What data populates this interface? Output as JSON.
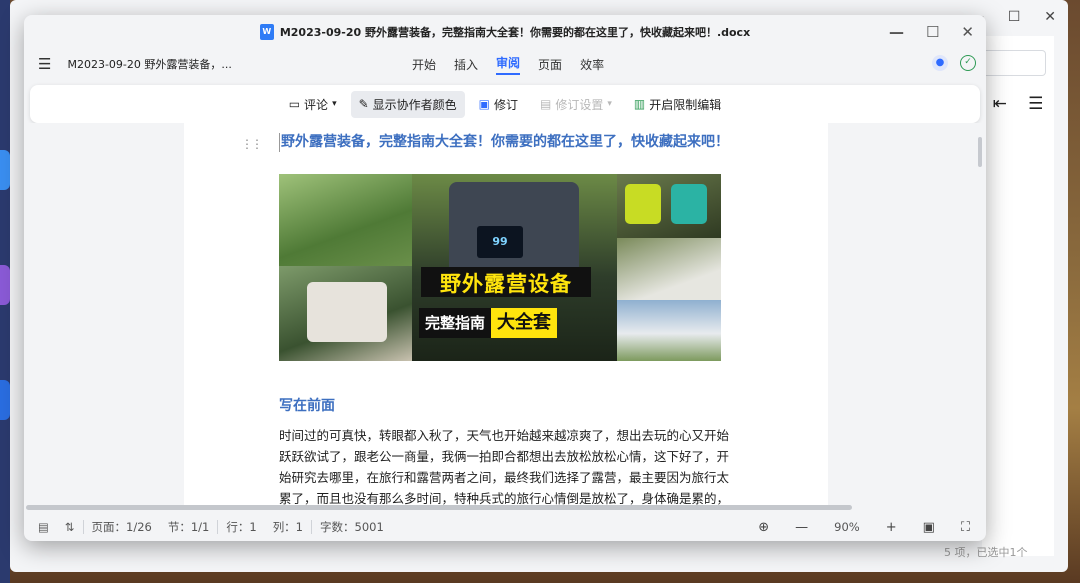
{
  "window": {
    "title": "M2023-09-20 野外露营装备，完整指南大全套！你需要的都在这里了，快收藏起来吧！.docx",
    "doc_short_title": "M2023-09-20 野外露营装备，...",
    "controls": {
      "minimize": "—",
      "maximize": "☐",
      "close": "✕"
    }
  },
  "menu": {
    "tabs": [
      "开始",
      "插入",
      "审阅",
      "页面",
      "效率"
    ],
    "active_tab": "审阅"
  },
  "toolbar": {
    "comment": "评论",
    "show_colors": "显示协作者颜色",
    "revise": "修订",
    "revise_settings": "修订设置",
    "restrict_edit": "开启限制编辑"
  },
  "document": {
    "title": "野外露营装备，完整指南大全套！你需要的都在这里了，快收藏起来吧！",
    "hero": {
      "line1": "野外露营设备",
      "line2_left": "完整指南",
      "line2_right": "大全套",
      "display_readout": "99"
    },
    "section_heading": "写在前面",
    "paragraph": "时间过的可真快，转眼都入秋了，天气也开始越来越凉爽了，想出去玩的心又开始跃跃欲试了，跟老公一商量，我俩一拍即合都想出去放松放松心情，这下好了，开始研究去哪里，在旅行和露营两者之间，最终我们选择了露营，最主要因为旅行太累了，而且也没有那么多时间，特种兵式的旅行心情倒是放松了，身体确是累的，"
  },
  "statusbar": {
    "page": "页面：1/26",
    "section": "节：1/1",
    "row": "行：1",
    "col": "列：1",
    "words": "字数：5001",
    "zoom": "90%"
  },
  "background": {
    "footer_text": "5 项，已选中1个"
  },
  "colors": {
    "accent": "#2f6bff",
    "heading": "#3d6fc0",
    "banner_yellow": "#ffe40d"
  }
}
